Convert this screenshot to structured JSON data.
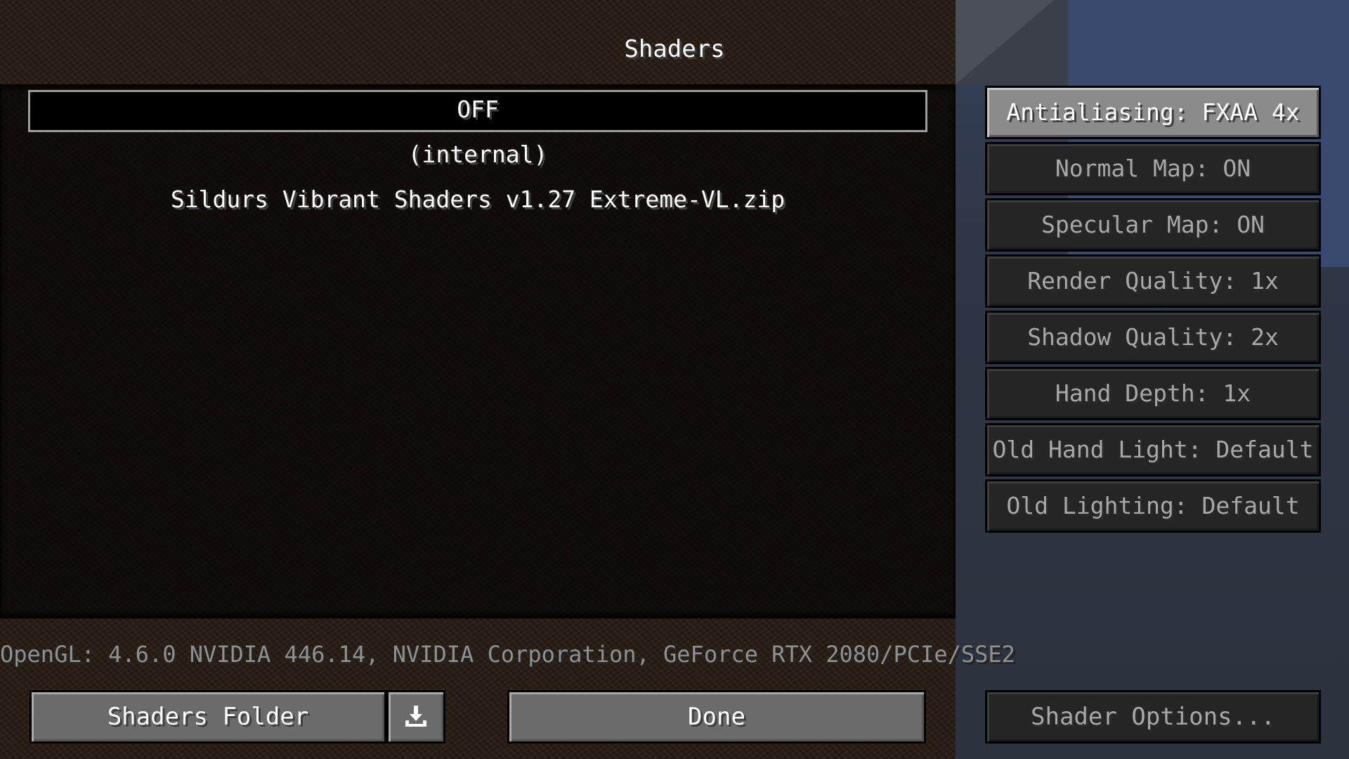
{
  "title": "Shaders",
  "shader_list": [
    {
      "label": "OFF",
      "selected": true
    },
    {
      "label": "(internal)",
      "selected": false
    },
    {
      "label": "Sildurs Vibrant Shaders v1.27 Extreme-VL.zip",
      "selected": false
    }
  ],
  "options": [
    {
      "label": "Antialiasing: FXAA 4x",
      "highlighted": true
    },
    {
      "label": "Normal Map: ON"
    },
    {
      "label": "Specular Map: ON"
    },
    {
      "label": "Render Quality: 1x"
    },
    {
      "label": "Shadow Quality: 2x"
    },
    {
      "label": "Hand Depth: 1x"
    },
    {
      "label": "Old Hand Light: Default"
    },
    {
      "label": "Old Lighting: Default"
    }
  ],
  "gl_info": "OpenGL: 4.6.0 NVIDIA 446.14, NVIDIA Corporation, GeForce RTX 2080/PCIe/SSE2",
  "buttons": {
    "shaders_folder": "Shaders Folder",
    "download_icon": "download-icon",
    "done": "Done",
    "shader_options": "Shader Options..."
  }
}
